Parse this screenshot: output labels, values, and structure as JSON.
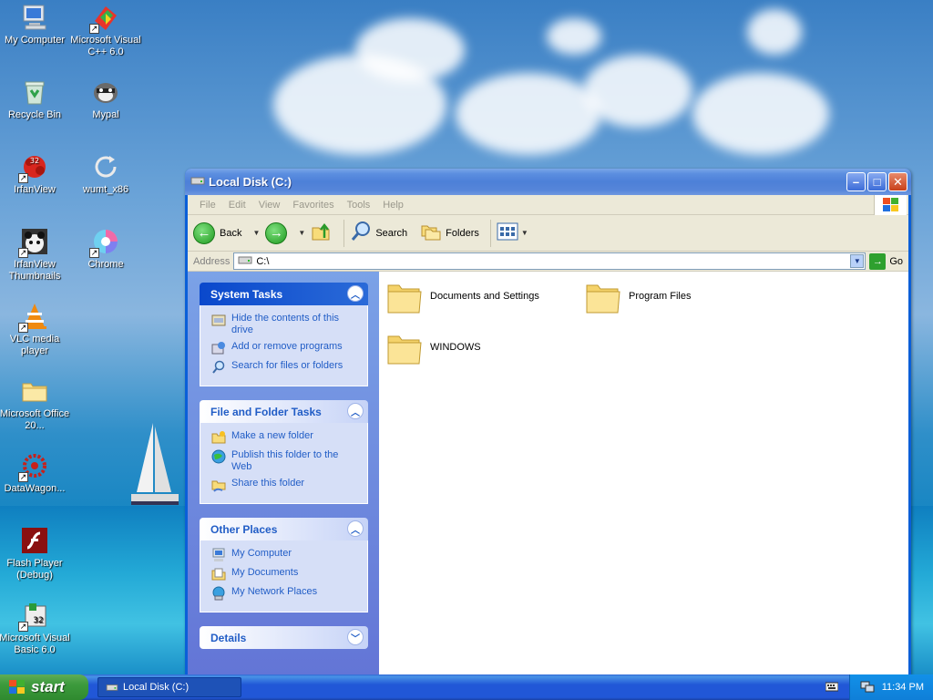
{
  "desktop": {
    "icons": [
      {
        "label": "My Computer"
      },
      {
        "label": "Microsoft Visual C++ 6.0"
      },
      {
        "label": "Recycle Bin"
      },
      {
        "label": "Mypal"
      },
      {
        "label": "IrfanView"
      },
      {
        "label": "wumt_x86"
      },
      {
        "label": "IrfanView Thumbnails"
      },
      {
        "label": "Chrome"
      },
      {
        "label": "VLC media player"
      },
      {
        "label": "Microsoft Office 20..."
      },
      {
        "label": "DataWagon..."
      },
      {
        "label": "Flash Player (Debug)"
      },
      {
        "label": "Microsoft Visual Basic 6.0"
      }
    ]
  },
  "window": {
    "title": "Local Disk (C:)",
    "menu": [
      "File",
      "Edit",
      "View",
      "Favorites",
      "Tools",
      "Help"
    ],
    "toolbar": {
      "back_label": "Back",
      "search_label": "Search",
      "folders_label": "Folders"
    },
    "address": {
      "label": "Address",
      "value": "C:\\",
      "go_label": "Go"
    },
    "panels": {
      "system_tasks": {
        "title": "System Tasks",
        "items": [
          "Hide the contents of this drive",
          "Add or remove programs",
          "Search for files or folders"
        ]
      },
      "file_folder_tasks": {
        "title": "File and Folder Tasks",
        "items": [
          "Make a new folder",
          "Publish this folder to the Web",
          "Share this folder"
        ]
      },
      "other_places": {
        "title": "Other Places",
        "items": [
          "My Computer",
          "My Documents",
          "My Network Places"
        ]
      },
      "details": {
        "title": "Details"
      }
    },
    "files": [
      "Documents and Settings",
      "Program Files",
      "WINDOWS"
    ]
  },
  "taskbar": {
    "start_label": "start",
    "task_label": "Local Disk (C:)",
    "clock": "11:34 PM"
  },
  "colors": {
    "title_bar": "#0a5fd8",
    "task_link": "#215dc6",
    "start_green": "#3c9a3c"
  }
}
